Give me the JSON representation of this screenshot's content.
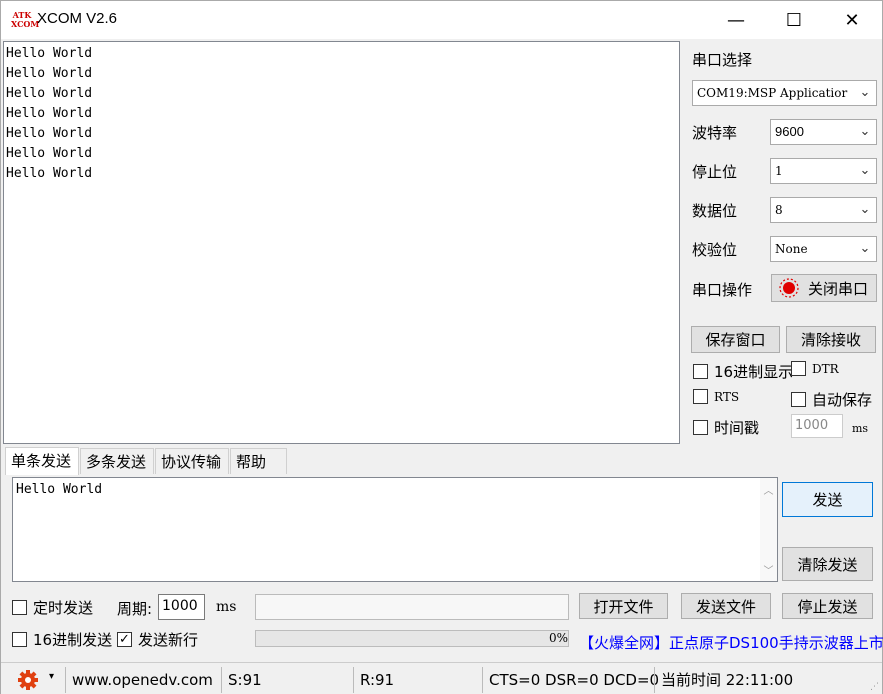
{
  "window": {
    "app_icon_line1": "ATK",
    "app_icon_line2": "XCOM",
    "title": "XCOM V2.6",
    "minimize": "—",
    "maximize": "☐",
    "close": "✕"
  },
  "receive": {
    "lines": [
      "Hello World",
      "Hello World",
      "Hello World",
      "Hello World",
      "Hello World",
      "Hello World",
      "Hello World"
    ]
  },
  "port": {
    "section_label": "串口选择",
    "port_value": "COM19:MSP Applicatior",
    "baud_label": "波特率",
    "baud_value": "9600",
    "stop_label": "停止位",
    "stop_value": "1",
    "data_label": "数据位",
    "data_value": "8",
    "parity_label": "校验位",
    "parity_value": "None",
    "op_label": "串口操作",
    "op_button": "关闭串口"
  },
  "receive_controls": {
    "save_window": "保存窗口",
    "clear_receive": "清除接收",
    "hex_display": "16进制显示",
    "dtr": "DTR",
    "rts": "RTS",
    "auto_save": "自动保存",
    "timestamp": "时间戳",
    "timestamp_value": "1000",
    "timestamp_unit": "ms"
  },
  "tabs": [
    "单条发送",
    "多条发送",
    "协议传输",
    "帮助"
  ],
  "send": {
    "text": "Hello World",
    "send_button": "发送",
    "clear_send": "清除发送",
    "timed_send": "定时发送",
    "period_label": "周期:",
    "period_value": "1000",
    "period_unit": "ms",
    "open_file": "打开文件",
    "send_file": "发送文件",
    "stop_send": "停止发送",
    "hex_send": "16进制发送",
    "send_newline": "发送新行",
    "newline_checked": "✓",
    "progress_text": "0%",
    "progress_value": 0,
    "ad_text": "【火爆全网】正点原子DS100手持示波器上市"
  },
  "statusbar": {
    "url": "www.openedv.com",
    "sent": "S:91",
    "received": "R:91",
    "signals": "CTS=0 DSR=0 DCD=0",
    "time": "当前时间 22:11:00"
  },
  "colors": {
    "accent": "#0078d7",
    "led_red": "#e00000",
    "gear_orange": "#e04010",
    "ad_blue": "#0000ff"
  }
}
